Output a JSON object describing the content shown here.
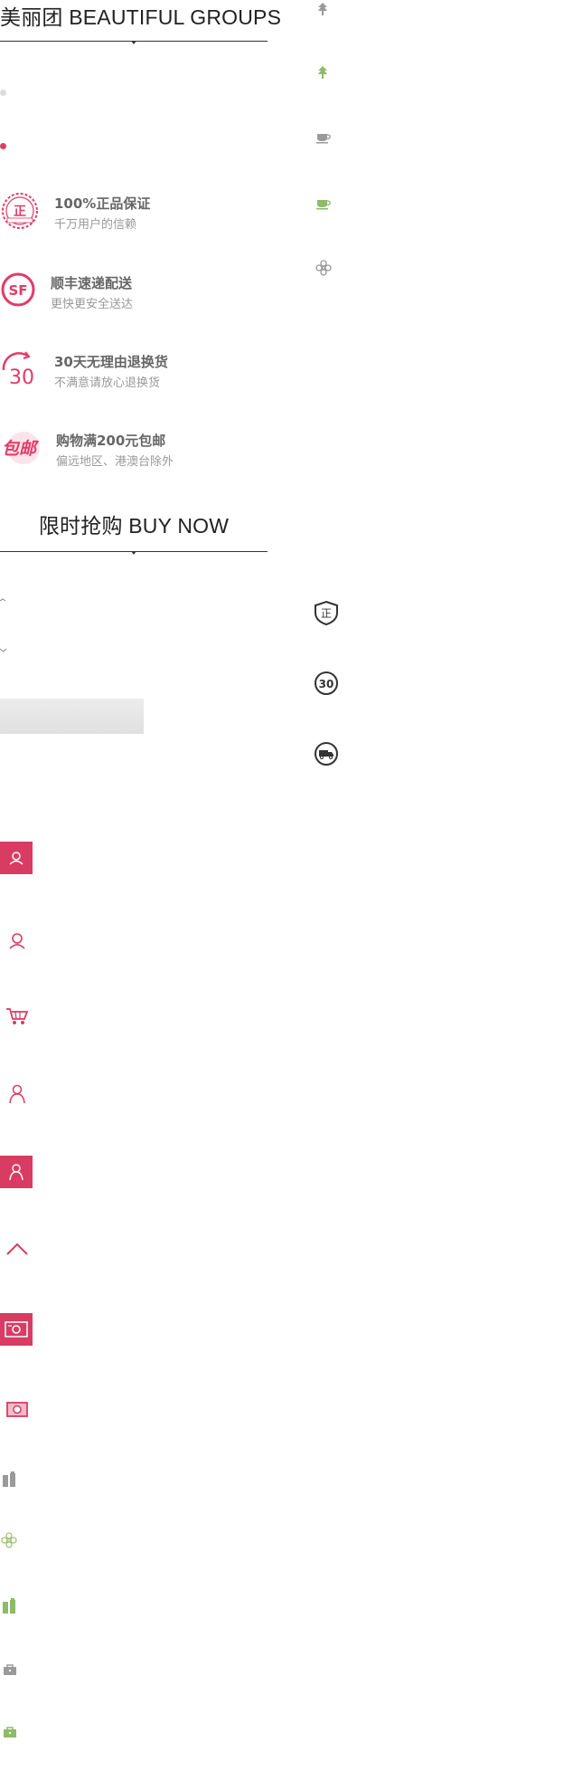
{
  "header": {
    "title": "美丽团 BEAUTIFUL GROUPS"
  },
  "guarantees": [
    {
      "icon": "authentic-badge-icon",
      "title": "100%正品保证",
      "subtitle": "千万用户的信赖"
    },
    {
      "icon": "sf-express-icon",
      "title": "顺丰速递配送",
      "subtitle": "更快更安全送达"
    },
    {
      "icon": "return-30-icon",
      "title": "30天无理由退换货",
      "subtitle": "不满意请放心退换货"
    },
    {
      "icon": "free-shipping-icon",
      "title": "购物满200元包邮",
      "subtitle": "偏远地区、港澳台除外"
    }
  ],
  "section2": {
    "title": "限时抢购 BUY NOW"
  },
  "colors": {
    "accent": "#d83c63",
    "green": "#8fba6a",
    "gray": "#8a8a8a",
    "placeholder": "#e6e6e6"
  }
}
